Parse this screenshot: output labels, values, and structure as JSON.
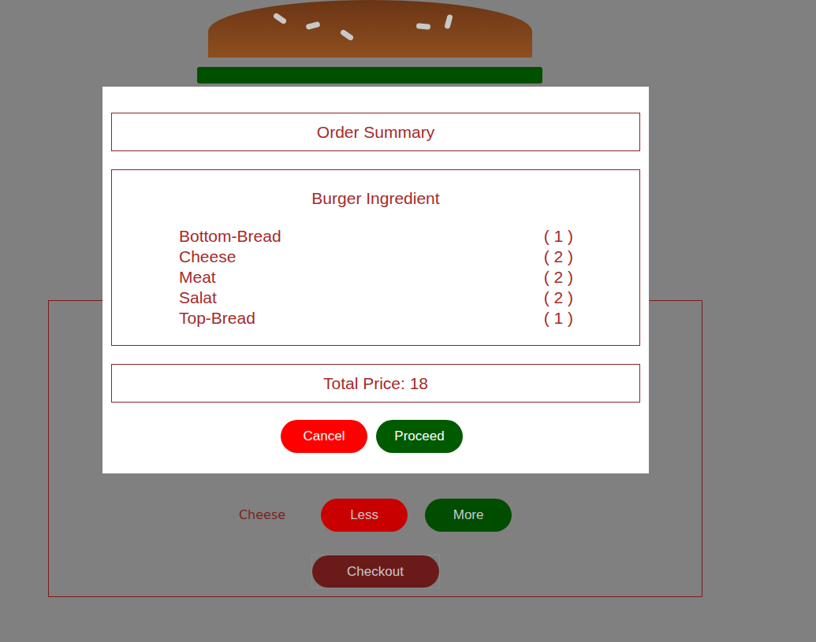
{
  "burger": {
    "visible_layers": [
      {
        "kind": "bread-top"
      },
      {
        "kind": "salad"
      }
    ]
  },
  "controls": [
    {
      "label": "Cheese",
      "less": "Less",
      "more": "More"
    }
  ],
  "checkout": "Checkout",
  "modal": {
    "title": "Order Summary",
    "section_title": "Burger Ingredient",
    "items": [
      {
        "name": "Bottom-Bread",
        "count": "( 1 )"
      },
      {
        "name": "Cheese",
        "count": "( 2 )"
      },
      {
        "name": "Meat",
        "count": "( 2 )"
      },
      {
        "name": "Salat",
        "count": "( 2 )"
      },
      {
        "name": "Top-Bread",
        "count": "( 1 )"
      }
    ],
    "total": "Total Price: 18",
    "buttons": [
      {
        "label": "Cancel",
        "color": "#ff0000"
      },
      {
        "label": "Proceed",
        "color": "#005a00"
      }
    ]
  }
}
